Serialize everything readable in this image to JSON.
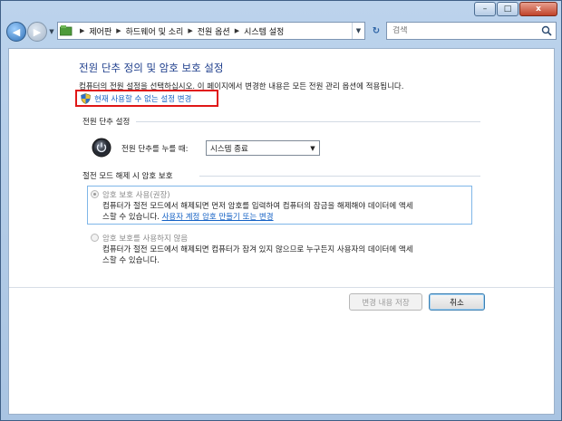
{
  "window": {
    "controls": {
      "minimize": "–",
      "maximize": "□",
      "close": "x"
    }
  },
  "nav": {
    "back": "◀",
    "forward": "▶",
    "breadcrumbs": [
      "제어판",
      "하드웨어 및 소리",
      "전원 옵션",
      "시스템 설정"
    ],
    "search_placeholder": "검색",
    "refresh": "↻"
  },
  "page": {
    "title": "전원 단추 정의 및 암호 보호 설정",
    "description": "컴퓨터의 전원 설정을 선택하십시오. 이 페이지에서 변경한 내용은 모든 전원 관리 옵션에 적용됩니다.",
    "change_link": "현재 사용할 수 없는 설정 변경"
  },
  "power": {
    "section_title": "전원 단추 설정",
    "label": "전원 단추를 누를 때:",
    "selected": "시스템 종료"
  },
  "wake": {
    "section_title": "절전 모드 해제 시 암호 보호",
    "options": [
      {
        "label": "암호 보호 사용(권장)",
        "desc_line1": "컴퓨터가 절전 모드에서 해제되면 먼저 암호를 입력하여 컴퓨터의 잠금을 해제해야 데이터에 액세",
        "desc_line2": "스할 수 있습니다.",
        "link": "사용자 계정 암호 만들기 또는 변경",
        "checked": true
      },
      {
        "label": "암호 보호를 사용하지 않음",
        "desc_line1": "컴퓨터가 절전 모드에서 해제되면 컴퓨터가 잠겨 있지 않으므로 누구든지 사용자의 데이터에 액세",
        "desc_line2": "스할 수 있습니다.",
        "checked": false
      }
    ]
  },
  "buttons": {
    "save": "변경 내용 저장",
    "cancel": "취소"
  },
  "colors": {
    "title_blue": "#1e3e8c",
    "link_blue": "#1461c4",
    "highlight_red": "#e01717"
  }
}
